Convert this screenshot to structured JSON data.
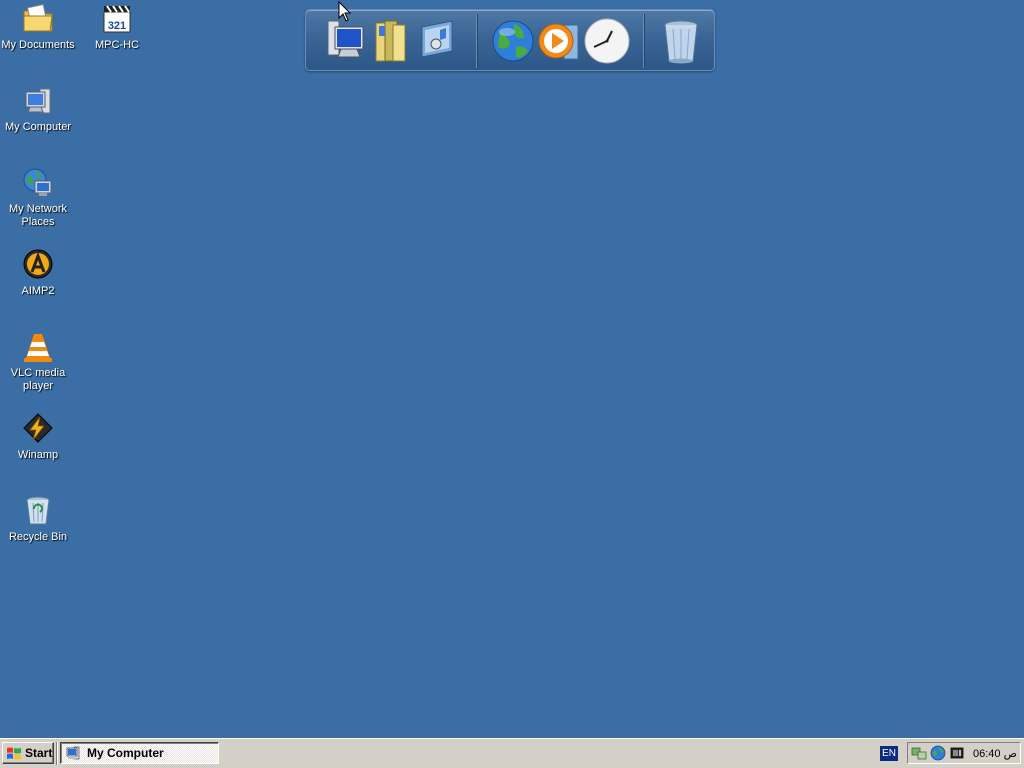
{
  "desktop": {
    "background_color": "#3a6ea5",
    "icons": [
      {
        "label": "My Documents",
        "icon": "my-documents-icon"
      },
      {
        "label": "MPC-HC",
        "icon": "mpc-hc-icon"
      },
      {
        "label": "My Computer",
        "icon": "my-computer-icon"
      },
      {
        "label": "My Network Places",
        "icon": "my-network-places-icon"
      },
      {
        "label": "AIMP2",
        "icon": "aimp2-icon"
      },
      {
        "label": "VLC media player",
        "icon": "vlc-icon"
      },
      {
        "label": "Winamp",
        "icon": "winamp-icon"
      },
      {
        "label": "Recycle Bin",
        "icon": "recycle-bin-icon"
      }
    ]
  },
  "dock": {
    "items": [
      "computer-icon",
      "folders-icon",
      "control-panel-icon",
      "internet-globe-icon",
      "media-player-icon",
      "clock-icon",
      "trash-icon"
    ]
  },
  "taskbar": {
    "start_label": "Start",
    "tasks": [
      {
        "label": "My Computer",
        "icon": "my-computer-icon"
      }
    ],
    "language": "EN",
    "tray_icons": [
      "network-icon",
      "globe-icon",
      "volume-icon"
    ],
    "clock": "06:40 ص"
  }
}
